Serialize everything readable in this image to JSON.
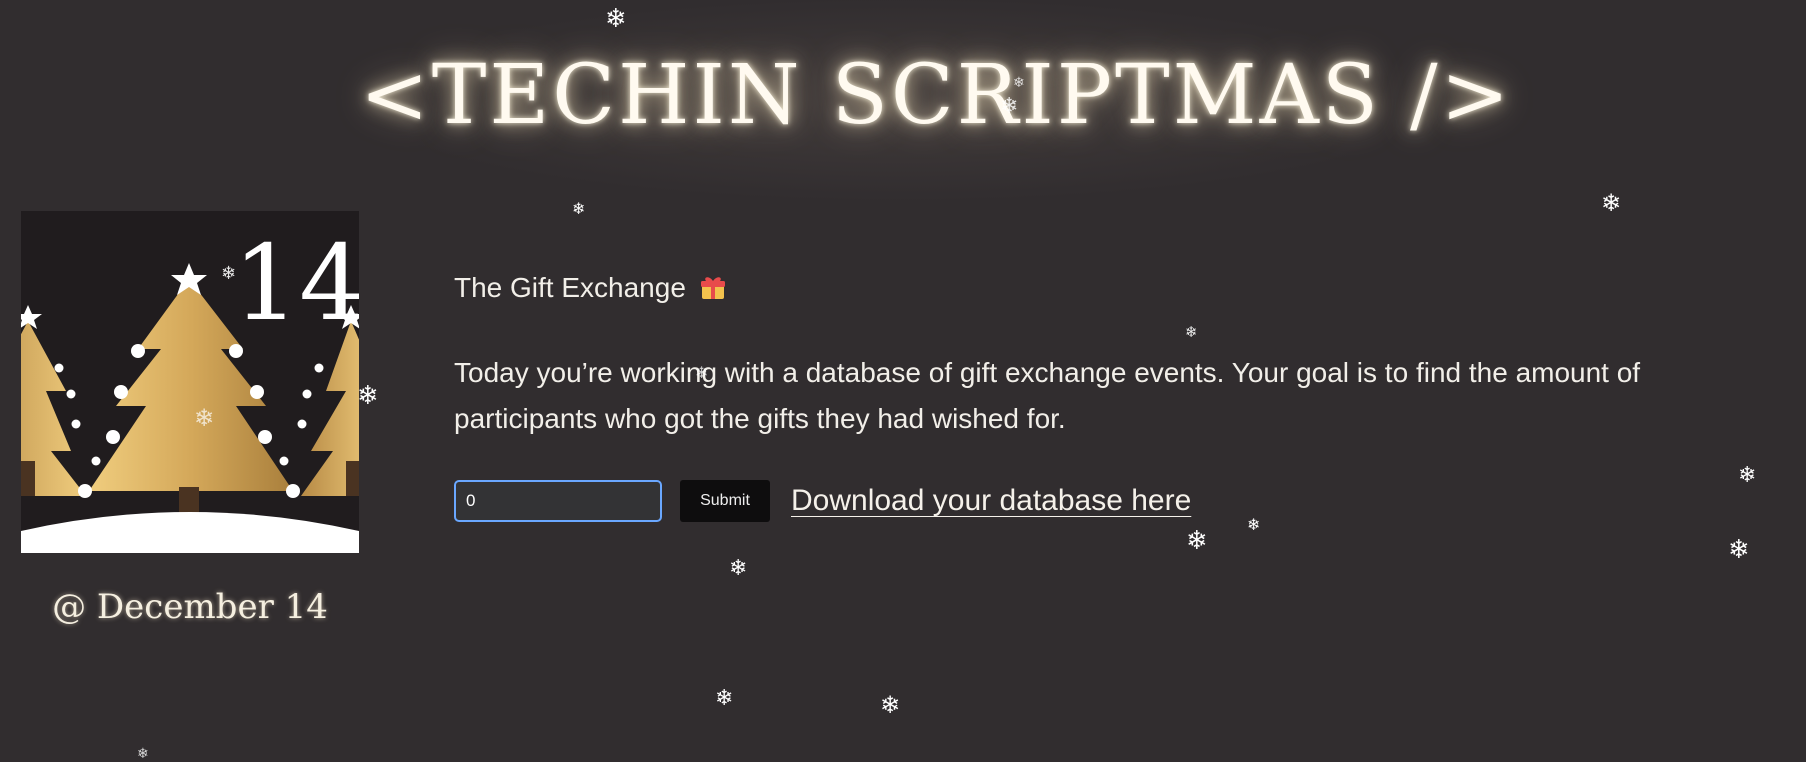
{
  "site": {
    "title": "<TECHIN SCRIPTMAS />"
  },
  "calendar_card": {
    "day_number": "14",
    "caption": "@ December 14"
  },
  "puzzle": {
    "title": "The Gift Exchange",
    "title_icon": "gift-icon",
    "description": "Today you’re working with a database of gift exchange events. Your goal is to find the amount of participants who got the gifts they had wished for.",
    "answer_value": "0",
    "submit_label": "Submit",
    "download_label": "Download your database here"
  },
  "decorations": {
    "snowflake_icon": "snowflake-icon",
    "snowflake_glyph": "❄"
  },
  "colors": {
    "background": "#312d2f",
    "gold_light": "#f0cd7e",
    "gold_dark": "#a97f3c",
    "input_border": "#6aa7ff",
    "button_bg": "#0e0d0e"
  }
}
